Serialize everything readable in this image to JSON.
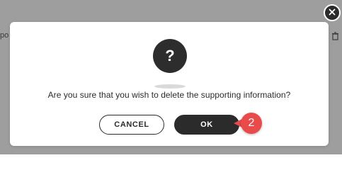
{
  "background": {
    "left_text": "po",
    "right_icon": "trash-icon"
  },
  "close": {
    "icon": "close-icon"
  },
  "dialog": {
    "icon": "question-mark-icon",
    "icon_glyph": "?",
    "message": "Are you sure that you wish to delete the supporting information?",
    "cancel_label": "CANCEL",
    "ok_label": "OK"
  },
  "annotation": {
    "step_number": "2",
    "color": "#e94b4b"
  }
}
